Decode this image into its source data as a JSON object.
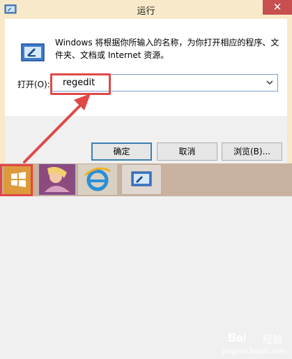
{
  "window": {
    "title": "运行",
    "close_symbol": "✕",
    "description": "Windows 将根据你所输入的名称，为你打开相应的程序、文件夹、文档或 Internet 资源。",
    "open_label": "打开(O):",
    "command_value": "regedit"
  },
  "buttons": {
    "ok": "确定",
    "cancel": "取消",
    "browse": "浏览(B)..."
  },
  "taskbar": {
    "items": [
      "start-icon",
      "app-icon",
      "ie-icon",
      "run-window-icon"
    ]
  },
  "watermark": {
    "brand": "Bai",
    "brand_cn": "经验",
    "url": "jingyan.baidu.com"
  },
  "colors": {
    "title_bar": "#f7e9c9",
    "close_button": "#c74f50",
    "highlight": "#e04848",
    "taskbar": "#c9b2a0",
    "start_tile": "#dd9a3c"
  }
}
